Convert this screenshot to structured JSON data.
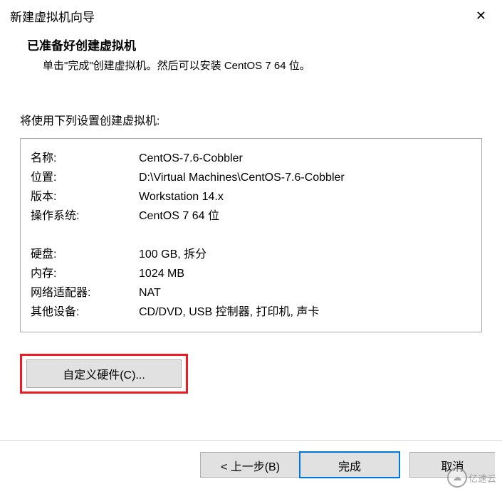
{
  "titlebar": {
    "title": "新建虚拟机向导",
    "close": "✕"
  },
  "header": {
    "heading": "已准备好创建虚拟机",
    "subheading": "单击\"完成\"创建虚拟机。然后可以安装 CentOS 7 64 位。"
  },
  "intro": "将使用下列设置创建虚拟机:",
  "settings": {
    "name_label": "名称:",
    "name_value": "CentOS-7.6-Cobbler",
    "location_label": "位置:",
    "location_value": "D:\\Virtual Machines\\CentOS-7.6-Cobbler",
    "version_label": "版本:",
    "version_value": "Workstation 14.x",
    "os_label": "操作系统:",
    "os_value": "CentOS 7 64 位",
    "disk_label": "硬盘:",
    "disk_value": "100 GB, 拆分",
    "memory_label": "内存:",
    "memory_value": "1024 MB",
    "network_label": "网络适配器:",
    "network_value": "NAT",
    "other_label": "其他设备:",
    "other_value": "CD/DVD, USB 控制器, 打印机, 声卡"
  },
  "buttons": {
    "customize_hw": "自定义硬件(C)...",
    "back": "< 上一步(B)",
    "finish": "完成",
    "cancel": "取消"
  },
  "watermark": {
    "icon": "☁",
    "text": "亿速云"
  }
}
